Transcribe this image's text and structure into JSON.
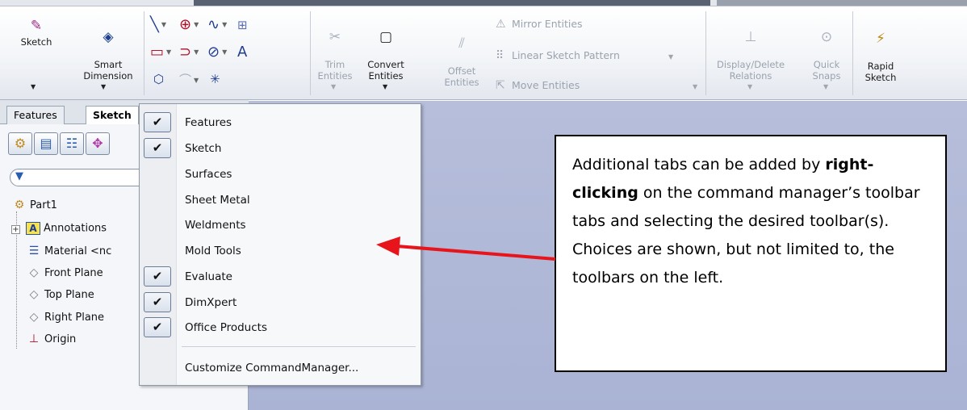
{
  "ribbon": {
    "sketch_label": "Sketch",
    "smart_dimension_label": "Smart\nDimension",
    "trim_entities_label": "Trim\nEntities",
    "convert_entities_label": "Convert\nEntities",
    "offset_entities_label": "Offset\nEntities",
    "mirror_entities_label": "Mirror Entities",
    "linear_sketch_pattern_label": "Linear Sketch Pattern",
    "move_entities_label": "Move Entities",
    "display_delete_relations_label": "Display/Delete\nRelations",
    "quick_snaps_label": "Quick\nSnaps",
    "rapid_sketch_label": "Rapid\nSketch"
  },
  "panel": {
    "tabs": [
      {
        "label": "Features"
      },
      {
        "label": "Sketch"
      }
    ],
    "tree": {
      "part": "Part1",
      "annotations": "Annotations",
      "material": "Material <nc",
      "front_plane": "Front Plane",
      "top_plane": "Top Plane",
      "right_plane": "Right Plane",
      "origin": "Origin"
    }
  },
  "menu": {
    "items": [
      {
        "label": "Features",
        "checked": true
      },
      {
        "label": "Sketch",
        "checked": true
      },
      {
        "label": "Surfaces",
        "checked": false
      },
      {
        "label": "Sheet Metal",
        "checked": false
      },
      {
        "label": "Weldments",
        "checked": false
      },
      {
        "label": "Mold Tools",
        "checked": false
      },
      {
        "label": "Evaluate",
        "checked": true
      },
      {
        "label": "DimXpert",
        "checked": true
      },
      {
        "label": "Office Products",
        "checked": true
      }
    ],
    "customize": "Customize CommandManager..."
  },
  "callout": {
    "text_before_bold": "Additional tabs can be added by ",
    "bold": "right-clicking",
    "text_after_bold": " on the command manager’s toolbar tabs and selecting the desired toolbar(s).  Choices are shown, but not limited to, the toolbars on the left."
  },
  "colors": {
    "arrow": "#e8141c",
    "graphics_area": "#b0b8d8",
    "check": "#111111"
  },
  "icons": {
    "sketch": "sketch-pencil-icon",
    "smart_dimension": "smart-dimension-icon",
    "check": "checkmark-icon"
  }
}
